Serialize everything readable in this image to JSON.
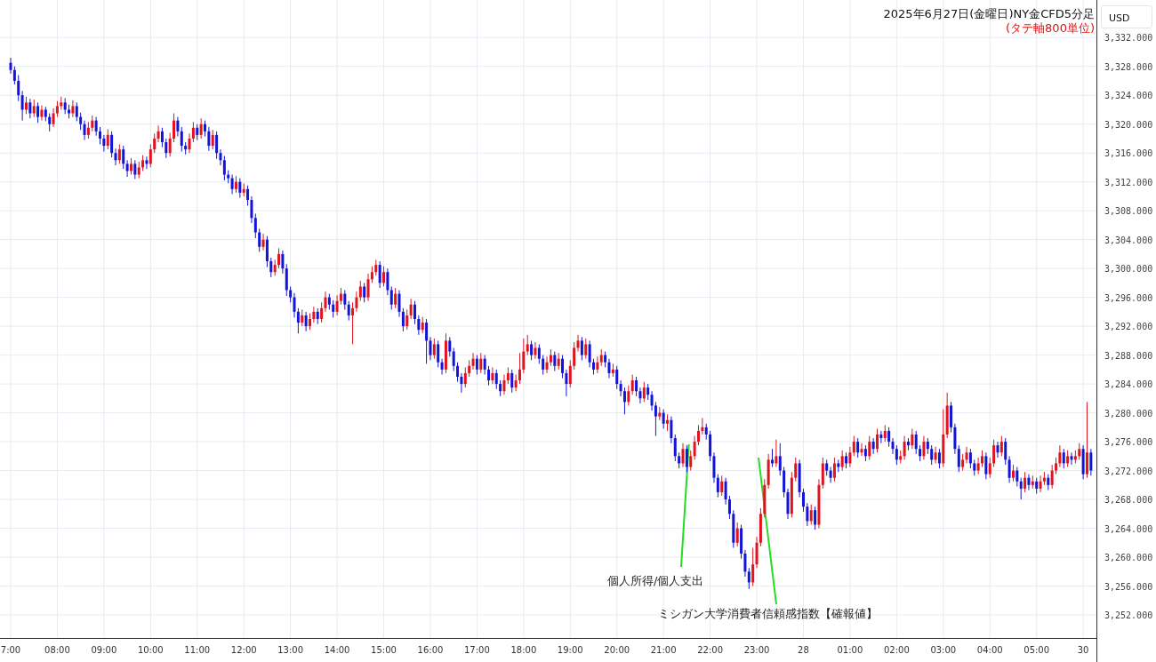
{
  "chart": {
    "subtitle": "(タテ軸800単位)",
    "currency": "USD",
    "chart_data": {
      "type": "candlestick",
      "title": "2025年6月27日(金曜日)NY金CFD5分足",
      "yticks": [
        {
          "value": 3332,
          "label": "3,332.000"
        },
        {
          "value": 3328,
          "label": "3,328.000"
        },
        {
          "value": 3324,
          "label": "3,324.000"
        },
        {
          "value": 3320,
          "label": "3,320.000"
        },
        {
          "value": 3316,
          "label": "3,316.000"
        },
        {
          "value": 3312,
          "label": "3,312.000"
        },
        {
          "value": 3308,
          "label": "3,308.000"
        },
        {
          "value": 3304,
          "label": "3,304.000"
        },
        {
          "value": 3300,
          "label": "3,300.000"
        },
        {
          "value": 3296,
          "label": "3,296.000"
        },
        {
          "value": 3292,
          "label": "3,292.000"
        },
        {
          "value": 3288,
          "label": "3,288.000"
        },
        {
          "value": 3284,
          "label": "3,284.000"
        },
        {
          "value": 3280,
          "label": "3,280.000"
        },
        {
          "value": 3276,
          "label": "3,276.000"
        },
        {
          "value": 3272,
          "label": "3,272.000"
        },
        {
          "value": 3268,
          "label": "3,268.000"
        },
        {
          "value": 3264,
          "label": "3,264.000"
        },
        {
          "value": 3260,
          "label": "3,260.000"
        },
        {
          "value": 3256,
          "label": "3,256.000"
        },
        {
          "value": 3252,
          "label": "3,252.000"
        }
      ],
      "ylim": [
        3248.8,
        3337.2
      ],
      "grid": true,
      "categories": [
        "7:00",
        null,
        null,
        null,
        null,
        null,
        null,
        null,
        null,
        null,
        null,
        null,
        "08:00",
        null,
        null,
        null,
        null,
        null,
        null,
        null,
        null,
        null,
        null,
        null,
        "09:00",
        null,
        null,
        null,
        null,
        null,
        null,
        null,
        null,
        null,
        null,
        null,
        "10:00",
        null,
        null,
        null,
        null,
        null,
        null,
        null,
        null,
        null,
        null,
        null,
        "11:00",
        null,
        null,
        null,
        null,
        null,
        null,
        null,
        null,
        null,
        null,
        null,
        "12:00",
        null,
        null,
        null,
        null,
        null,
        null,
        null,
        null,
        null,
        null,
        null,
        "13:00",
        null,
        null,
        null,
        null,
        null,
        null,
        null,
        null,
        null,
        null,
        null,
        "14:00",
        null,
        null,
        null,
        null,
        null,
        null,
        null,
        null,
        null,
        null,
        null,
        "15:00",
        null,
        null,
        null,
        null,
        null,
        null,
        null,
        null,
        null,
        null,
        null,
        "16:00",
        null,
        null,
        null,
        null,
        null,
        null,
        null,
        null,
        null,
        null,
        null,
        "17:00",
        null,
        null,
        null,
        null,
        null,
        null,
        null,
        null,
        null,
        null,
        null,
        "18:00",
        null,
        null,
        null,
        null,
        null,
        null,
        null,
        null,
        null,
        null,
        null,
        "19:00",
        null,
        null,
        null,
        null,
        null,
        null,
        null,
        null,
        null,
        null,
        null,
        "20:00",
        null,
        null,
        null,
        null,
        null,
        null,
        null,
        null,
        null,
        null,
        null,
        "21:00",
        null,
        null,
        null,
        null,
        null,
        null,
        null,
        null,
        null,
        null,
        null,
        "22:00",
        null,
        null,
        null,
        null,
        null,
        null,
        null,
        null,
        null,
        null,
        null,
        "23:00",
        null,
        null,
        null,
        null,
        null,
        null,
        null,
        null,
        null,
        null,
        null,
        "28",
        null,
        null,
        null,
        null,
        null,
        null,
        null,
        null,
        null,
        null,
        null,
        "01:00",
        null,
        null,
        null,
        null,
        null,
        null,
        null,
        null,
        null,
        null,
        null,
        "02:00",
        null,
        null,
        null,
        null,
        null,
        null,
        null,
        null,
        null,
        null,
        null,
        "03:00",
        null,
        null,
        null,
        null,
        null,
        null,
        null,
        null,
        null,
        null,
        null,
        "04:00",
        null,
        null,
        null,
        null,
        null,
        null,
        null,
        null,
        null,
        null,
        null,
        "05:00",
        null,
        null,
        null,
        null,
        null,
        null,
        null,
        null,
        null,
        null,
        null,
        "30",
        null,
        null
      ],
      "ohlc": [
        [
          3328.5,
          3329.2,
          3327,
          3327.5
        ],
        [
          3327.5,
          3328,
          3325.5,
          3326
        ],
        [
          3326,
          3326.8,
          3323.2,
          3324
        ],
        [
          3324,
          3324.6,
          3320.5,
          3322
        ],
        [
          3322,
          3323.8,
          3321.4,
          3323
        ],
        [
          3323,
          3323.5,
          3320.8,
          3321.5
        ],
        [
          3321.5,
          3323.4,
          3321,
          3322.5
        ],
        [
          3322.5,
          3323,
          3320.2,
          3321
        ],
        [
          3321,
          3322.6,
          3320.5,
          3322
        ],
        [
          3322,
          3322.4,
          3320.4,
          3321
        ],
        [
          3321,
          3321.5,
          3319,
          3320
        ],
        [
          3320,
          3322.2,
          3319.6,
          3321.5
        ],
        [
          3321.5,
          3323.2,
          3321,
          3322.5
        ],
        [
          3322.5,
          3323.8,
          3322,
          3323
        ],
        [
          3323,
          3323.6,
          3321.4,
          3322
        ],
        [
          3322,
          3322.7,
          3320.8,
          3321.5
        ],
        [
          3321.5,
          3323.3,
          3321,
          3322.5
        ],
        [
          3322.5,
          3323,
          3320.4,
          3321
        ],
        [
          3321,
          3321.6,
          3319.2,
          3320
        ],
        [
          3320,
          3320.5,
          3317.8,
          3318.5
        ],
        [
          3318.5,
          3320.3,
          3318,
          3319.5
        ],
        [
          3319.5,
          3321.2,
          3319,
          3320.5
        ],
        [
          3320.5,
          3321,
          3318.4,
          3319
        ],
        [
          3319,
          3319.6,
          3317.2,
          3318
        ],
        [
          3318,
          3318.5,
          3316.2,
          3317
        ],
        [
          3317,
          3319.3,
          3316.5,
          3318.5
        ],
        [
          3318.5,
          3319,
          3315.4,
          3316
        ],
        [
          3316,
          3316.6,
          3314.3,
          3315
        ],
        [
          3315,
          3317.2,
          3314.5,
          3316.5
        ],
        [
          3316.5,
          3317,
          3313.8,
          3314.5
        ],
        [
          3314.5,
          3315,
          3312.7,
          3313.5
        ],
        [
          3313.5,
          3315.3,
          3313,
          3314.5
        ],
        [
          3314.5,
          3315,
          3312.4,
          3313
        ],
        [
          3313,
          3314.8,
          3312.5,
          3314
        ],
        [
          3314,
          3315.7,
          3313.5,
          3315
        ],
        [
          3315,
          3315.5,
          3313.8,
          3314.5
        ],
        [
          3314.5,
          3317.2,
          3314,
          3316.5
        ],
        [
          3316.5,
          3318.7,
          3316,
          3318
        ],
        [
          3318,
          3319.8,
          3317.5,
          3319
        ],
        [
          3319,
          3319.5,
          3316.8,
          3317.5
        ],
        [
          3317.5,
          3318,
          3315.3,
          3316
        ],
        [
          3316,
          3318.8,
          3315.5,
          3318
        ],
        [
          3318,
          3321.5,
          3317.5,
          3320.5
        ],
        [
          3320.5,
          3321,
          3318.3,
          3319
        ],
        [
          3319,
          3319.6,
          3316.2,
          3317
        ],
        [
          3317,
          3317.5,
          3315.8,
          3316.5
        ],
        [
          3316.5,
          3318.7,
          3316,
          3318
        ],
        [
          3318,
          3320.3,
          3317.5,
          3319.5
        ],
        [
          3319.5,
          3320,
          3317.8,
          3318.5
        ],
        [
          3318.5,
          3320.8,
          3318,
          3320
        ],
        [
          3320,
          3320.5,
          3318.3,
          3319
        ],
        [
          3319,
          3319.6,
          3316.3,
          3317
        ],
        [
          3317,
          3319.2,
          3316.5,
          3318.5
        ],
        [
          3318.5,
          3319,
          3315.2,
          3316
        ],
        [
          3316,
          3316.5,
          3314.3,
          3315
        ],
        [
          3315,
          3315.6,
          3312.2,
          3313
        ],
        [
          3313,
          3313.6,
          3311.8,
          3312.5
        ],
        [
          3312.5,
          3313,
          3310.3,
          3311
        ],
        [
          3311,
          3312.8,
          3310.5,
          3312
        ],
        [
          3312,
          3312.5,
          3309.8,
          3310.5
        ],
        [
          3310.5,
          3311.8,
          3310,
          3311
        ],
        [
          3311,
          3311.5,
          3308.7,
          3309.5
        ],
        [
          3309.5,
          3310,
          3306.3,
          3307
        ],
        [
          3307,
          3307.6,
          3304.2,
          3305
        ],
        [
          3305,
          3305.5,
          3302.3,
          3303
        ],
        [
          3303,
          3304.8,
          3302.5,
          3304
        ],
        [
          3304,
          3304.5,
          3300.2,
          3301
        ],
        [
          3301,
          3301.5,
          3298.8,
          3299.5
        ],
        [
          3299.5,
          3301.2,
          3299,
          3300.5
        ],
        [
          3300.5,
          3302.8,
          3300,
          3302
        ],
        [
          3302,
          3302.5,
          3299.3,
          3300
        ],
        [
          3300,
          3300.6,
          3296.2,
          3297
        ],
        [
          3297,
          3297.5,
          3295.3,
          3296
        ],
        [
          3296,
          3296.6,
          3293.2,
          3294
        ],
        [
          3294,
          3294.5,
          3291,
          3292.5
        ],
        [
          3292.5,
          3294.3,
          3292,
          3293.5
        ],
        [
          3293.5,
          3294,
          3291.3,
          3292
        ],
        [
          3292,
          3293.8,
          3291.5,
          3293
        ],
        [
          3293,
          3294.7,
          3292.5,
          3294
        ],
        [
          3294,
          3294.5,
          3292.3,
          3293
        ],
        [
          3293,
          3295.3,
          3292.5,
          3294.5
        ],
        [
          3294.5,
          3296.8,
          3294,
          3296
        ],
        [
          3296,
          3296.5,
          3294.3,
          3295
        ],
        [
          3295,
          3295.6,
          3293.2,
          3294
        ],
        [
          3294,
          3296.3,
          3293.5,
          3295.5
        ],
        [
          3295.5,
          3297.3,
          3295,
          3296.5
        ],
        [
          3296.5,
          3297,
          3294.3,
          3295
        ],
        [
          3295,
          3295.5,
          3292.8,
          3293.5
        ],
        [
          3293.5,
          3295.3,
          3289.5,
          3294.5
        ],
        [
          3294.5,
          3296.8,
          3294,
          3296
        ],
        [
          3296,
          3298.3,
          3295.5,
          3297.5
        ],
        [
          3297.5,
          3298,
          3295.3,
          3296
        ],
        [
          3296,
          3299.3,
          3295.5,
          3298.5
        ],
        [
          3298.5,
          3300.3,
          3298,
          3299.5
        ],
        [
          3299.5,
          3301.2,
          3299,
          3300.5
        ],
        [
          3300.5,
          3301,
          3297.3,
          3298
        ],
        [
          3298,
          3300.3,
          3297.5,
          3299.5
        ],
        [
          3299.5,
          3300,
          3296.3,
          3297
        ],
        [
          3297,
          3297.5,
          3294.3,
          3295
        ],
        [
          3295,
          3297.3,
          3294.5,
          3296.5
        ],
        [
          3296.5,
          3297,
          3293.3,
          3294
        ],
        [
          3294,
          3294.5,
          3291.3,
          3292
        ],
        [
          3292,
          3294.3,
          3291.5,
          3293.5
        ],
        [
          3293.5,
          3295.8,
          3293,
          3295
        ],
        [
          3295,
          3295.5,
          3292.3,
          3293
        ],
        [
          3293,
          3293.5,
          3290.8,
          3291.5
        ],
        [
          3291.5,
          3293.3,
          3291,
          3292.5
        ],
        [
          3292.5,
          3293,
          3286.8,
          3290
        ],
        [
          3290,
          3290.5,
          3287.3,
          3288
        ],
        [
          3288,
          3290.3,
          3287.5,
          3289.5
        ],
        [
          3289.5,
          3290,
          3286.3,
          3287
        ],
        [
          3287,
          3287.5,
          3285.3,
          3286
        ],
        [
          3286,
          3291,
          3285.5,
          3290
        ],
        [
          3290,
          3290.5,
          3287.8,
          3288.5
        ],
        [
          3288.5,
          3289,
          3285.8,
          3286.5
        ],
        [
          3286.5,
          3287,
          3284.3,
          3285
        ],
        [
          3285,
          3285.5,
          3282.8,
          3284
        ],
        [
          3284,
          3286.3,
          3283.5,
          3285.5
        ],
        [
          3285.5,
          3287.3,
          3285,
          3286.5
        ],
        [
          3286.5,
          3288.3,
          3286,
          3287.5
        ],
        [
          3287.5,
          3288,
          3285.3,
          3286
        ],
        [
          3286,
          3288.3,
          3285.5,
          3287.5
        ],
        [
          3287.5,
          3288,
          3285.3,
          3286
        ],
        [
          3286,
          3286.5,
          3283.8,
          3284.5
        ],
        [
          3284.5,
          3286.3,
          3284,
          3285.5
        ],
        [
          3285.5,
          3286,
          3283.3,
          3284
        ],
        [
          3284,
          3284.5,
          3282.3,
          3283
        ],
        [
          3283,
          3285.3,
          3282.5,
          3284.5
        ],
        [
          3284.5,
          3286.3,
          3284,
          3285.5
        ],
        [
          3285.5,
          3286,
          3282.8,
          3283.5
        ],
        [
          3283.5,
          3285.3,
          3283,
          3284.5
        ],
        [
          3284.5,
          3288.3,
          3284,
          3286
        ],
        [
          3286,
          3290.3,
          3285.5,
          3288.5
        ],
        [
          3288.5,
          3290.8,
          3288,
          3289.5
        ],
        [
          3289.5,
          3290,
          3287.3,
          3288
        ],
        [
          3288,
          3289.8,
          3287.5,
          3289
        ],
        [
          3289,
          3289.5,
          3286.8,
          3287.5
        ],
        [
          3287.5,
          3288,
          3285.3,
          3286
        ],
        [
          3286,
          3287.8,
          3285.5,
          3287
        ],
        [
          3287,
          3288.8,
          3286.5,
          3288
        ],
        [
          3288,
          3288.5,
          3285.8,
          3286.5
        ],
        [
          3286.5,
          3288.3,
          3286,
          3287.5
        ],
        [
          3287.5,
          3288,
          3284.8,
          3285.5
        ],
        [
          3285.5,
          3286,
          3282.3,
          3284
        ],
        [
          3284,
          3287.3,
          3283.5,
          3286.5
        ],
        [
          3286.5,
          3289.8,
          3286,
          3289
        ],
        [
          3289,
          3290.8,
          3288.5,
          3290
        ],
        [
          3290,
          3290.5,
          3287.3,
          3288
        ],
        [
          3288,
          3290.3,
          3287.5,
          3289.5
        ],
        [
          3289.5,
          3290,
          3286.3,
          3287
        ],
        [
          3287,
          3287.5,
          3285.3,
          3286
        ],
        [
          3286,
          3287.8,
          3285.5,
          3287
        ],
        [
          3287,
          3288.8,
          3286.5,
          3288
        ],
        [
          3288,
          3288.5,
          3286.3,
          3287
        ],
        [
          3287,
          3287.5,
          3284.8,
          3285.5
        ],
        [
          3285.5,
          3286.8,
          3285,
          3286
        ],
        [
          3286,
          3286.5,
          3283.3,
          3284
        ],
        [
          3284,
          3284.5,
          3282.3,
          3283
        ],
        [
          3283,
          3283.5,
          3279.8,
          3281.5
        ],
        [
          3281.5,
          3283.8,
          3281,
          3283
        ],
        [
          3283,
          3285.3,
          3282.5,
          3284.5
        ],
        [
          3284.5,
          3285,
          3282.3,
          3283
        ],
        [
          3283,
          3283.5,
          3281.3,
          3282
        ],
        [
          3282,
          3284.3,
          3281.5,
          3283.5
        ],
        [
          3283.5,
          3284,
          3281.8,
          3282.5
        ],
        [
          3282.5,
          3283,
          3280.3,
          3281
        ],
        [
          3281,
          3281.5,
          3276.8,
          3279.5
        ],
        [
          3279.5,
          3280.8,
          3279,
          3280
        ],
        [
          3280,
          3280.5,
          3277.8,
          3278.5
        ],
        [
          3278.5,
          3279.8,
          3277.5,
          3279
        ],
        [
          3279,
          3279.5,
          3275.8,
          3276.5
        ],
        [
          3276.5,
          3277,
          3273.3,
          3274
        ],
        [
          3274,
          3274.5,
          3272.3,
          3273
        ],
        [
          3273,
          3275.8,
          3272.5,
          3275
        ],
        [
          3275,
          3275.5,
          3271.8,
          3272.5
        ],
        [
          3272.5,
          3274.8,
          3272,
          3274
        ],
        [
          3274,
          3276.8,
          3273.5,
          3276
        ],
        [
          3276,
          3278.3,
          3275.5,
          3277.5
        ],
        [
          3277.5,
          3279.3,
          3277,
          3278
        ],
        [
          3278,
          3278.5,
          3276.3,
          3277
        ],
        [
          3277,
          3277.5,
          3273.3,
          3274
        ],
        [
          3274,
          3274.5,
          3270.3,
          3271
        ],
        [
          3271,
          3271.5,
          3268.3,
          3269
        ],
        [
          3269,
          3271.3,
          3268.5,
          3270.5
        ],
        [
          3270.5,
          3271,
          3267.3,
          3268
        ],
        [
          3268,
          3268.5,
          3265.3,
          3266
        ],
        [
          3266,
          3266.5,
          3261.3,
          3262
        ],
        [
          3262,
          3264.8,
          3261.5,
          3264
        ],
        [
          3264,
          3264.5,
          3259.8,
          3260.5
        ],
        [
          3260.5,
          3261,
          3257.3,
          3258
        ],
        [
          3258,
          3258.5,
          3255.6,
          3256.5
        ],
        [
          3256.5,
          3261.3,
          3256,
          3259
        ],
        [
          3259,
          3262.8,
          3258.5,
          3262
        ],
        [
          3262,
          3266.8,
          3261.5,
          3266
        ],
        [
          3266,
          3270.8,
          3265.5,
          3270
        ],
        [
          3270,
          3274.3,
          3269.5,
          3273.5
        ],
        [
          3273.5,
          3275,
          3272.5,
          3273
        ],
        [
          3273,
          3276.3,
          3272.5,
          3274
        ],
        [
          3274,
          3275.8,
          3271.3,
          3272
        ],
        [
          3272,
          3272.5,
          3268.3,
          3269
        ],
        [
          3269,
          3269.5,
          3265.3,
          3266
        ],
        [
          3266,
          3271.8,
          3265.5,
          3271
        ],
        [
          3271,
          3273.8,
          3270.5,
          3273
        ],
        [
          3273,
          3273.5,
          3268.3,
          3269
        ],
        [
          3269,
          3269.5,
          3266.3,
          3267
        ],
        [
          3267,
          3267.5,
          3264.3,
          3265
        ],
        [
          3265,
          3267.3,
          3264.5,
          3266.5
        ],
        [
          3266.5,
          3267,
          3263.8,
          3264.5
        ],
        [
          3264.5,
          3270.8,
          3264,
          3270
        ],
        [
          3270,
          3273.8,
          3269.5,
          3273
        ],
        [
          3273,
          3273.5,
          3271.3,
          3272
        ],
        [
          3272,
          3272.5,
          3270.3,
          3271
        ],
        [
          3271,
          3273.8,
          3270.5,
          3273
        ],
        [
          3273,
          3273.5,
          3271.8,
          3272.5
        ],
        [
          3272.5,
          3274.8,
          3272,
          3274
        ],
        [
          3274,
          3274.5,
          3272.3,
          3273
        ],
        [
          3273,
          3275.3,
          3272.5,
          3274.5
        ],
        [
          3274.5,
          3276.8,
          3274,
          3276
        ],
        [
          3276,
          3276.5,
          3273.8,
          3274.5
        ],
        [
          3274.5,
          3275.8,
          3274,
          3275
        ],
        [
          3275,
          3275.5,
          3273.3,
          3274
        ],
        [
          3274,
          3276.8,
          3273.5,
          3276
        ],
        [
          3276,
          3276.5,
          3274.3,
          3275
        ],
        [
          3275,
          3277.8,
          3274.5,
          3277
        ],
        [
          3277,
          3277.5,
          3275.8,
          3276.5
        ],
        [
          3276.5,
          3278.3,
          3276,
          3277.5
        ],
        [
          3277.5,
          3278,
          3275.3,
          3276
        ],
        [
          3276,
          3276.5,
          3274.3,
          3275
        ],
        [
          3275,
          3275.5,
          3272.8,
          3273.5
        ],
        [
          3273.5,
          3274.8,
          3273,
          3274
        ],
        [
          3274,
          3276.8,
          3273.5,
          3276
        ],
        [
          3276,
          3276.5,
          3274.8,
          3275.5
        ],
        [
          3275.5,
          3277.8,
          3275,
          3277
        ],
        [
          3277,
          3277.5,
          3274.3,
          3275
        ],
        [
          3275,
          3275.5,
          3273.3,
          3274
        ],
        [
          3274,
          3276.8,
          3273.5,
          3276
        ],
        [
          3276,
          3276.5,
          3274.3,
          3275
        ],
        [
          3275,
          3275.5,
          3272.8,
          3273.5
        ],
        [
          3273.5,
          3275.3,
          3273,
          3274.5
        ],
        [
          3274.5,
          3275,
          3272.3,
          3273
        ],
        [
          3273,
          3280.5,
          3272.5,
          3277
        ],
        [
          3277,
          3282.8,
          3276.5,
          3281
        ],
        [
          3281,
          3281.5,
          3277.3,
          3278
        ],
        [
          3278,
          3278.5,
          3274.3,
          3275
        ],
        [
          3275,
          3275.5,
          3271.8,
          3272.5
        ],
        [
          3272.5,
          3274.3,
          3272,
          3273.5
        ],
        [
          3273.5,
          3275.3,
          3273,
          3274.5
        ],
        [
          3274.5,
          3275,
          3272.3,
          3273
        ],
        [
          3273,
          3273.5,
          3271.3,
          3272
        ],
        [
          3272,
          3273.8,
          3271.5,
          3273
        ],
        [
          3273,
          3274.8,
          3272.5,
          3274
        ],
        [
          3274,
          3274.5,
          3270.8,
          3271.5
        ],
        [
          3271.5,
          3273.8,
          3271,
          3273
        ],
        [
          3273,
          3276.3,
          3272.5,
          3275.5
        ],
        [
          3275.5,
          3276,
          3273.8,
          3274.5
        ],
        [
          3274.5,
          3276.8,
          3274,
          3276
        ],
        [
          3276,
          3276.5,
          3272.8,
          3273.5
        ],
        [
          3273.5,
          3274,
          3270.3,
          3271
        ],
        [
          3271,
          3272.8,
          3270.5,
          3272
        ],
        [
          3272,
          3272.5,
          3269.8,
          3270.5
        ],
        [
          3270.5,
          3271,
          3268,
          3269.5
        ],
        [
          3269.5,
          3271.8,
          3269,
          3271
        ],
        [
          3271,
          3271.5,
          3269.3,
          3270
        ],
        [
          3270,
          3271.3,
          3269.5,
          3270.5
        ],
        [
          3270.5,
          3271,
          3268.8,
          3269.5
        ],
        [
          3269.5,
          3271.3,
          3269,
          3270.5
        ],
        [
          3270.5,
          3271.8,
          3270,
          3271
        ],
        [
          3271,
          3271.5,
          3269.3,
          3270
        ],
        [
          3270,
          3272.8,
          3269.5,
          3272
        ],
        [
          3272,
          3273.8,
          3271.5,
          3273
        ],
        [
          3273,
          3275.5,
          3272.5,
          3274.5
        ],
        [
          3274.5,
          3275,
          3272.3,
          3273
        ],
        [
          3273,
          3274.8,
          3272.5,
          3274
        ],
        [
          3274,
          3274.5,
          3272.8,
          3273.5
        ],
        [
          3273.5,
          3274.8,
          3273,
          3274
        ],
        [
          3274,
          3275.8,
          3273.5,
          3275
        ],
        [
          3275,
          3275.5,
          3270.8,
          3271.5
        ],
        [
          3271.5,
          3281.5,
          3271,
          3274.5
        ],
        [
          3274.5,
          3275,
          3271.3,
          3272
        ]
      ]
    },
    "annotations": [
      {
        "text": "個人所得/個人支出"
      },
      {
        "text": "ミシガン大学消費者信頼感指数【確報値】"
      }
    ]
  }
}
